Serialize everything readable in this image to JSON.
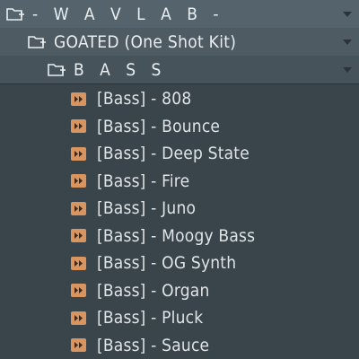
{
  "browser": {
    "root": {
      "label": "- W A V L A B -"
    },
    "kit": {
      "label": "GOATED (One Shot Kit)"
    },
    "subfolder": {
      "label": "B A S S"
    },
    "samples": [
      {
        "label": "[Bass] - 808"
      },
      {
        "label": "[Bass] - Bounce"
      },
      {
        "label": "[Bass] - Deep State"
      },
      {
        "label": "[Bass] - Fire"
      },
      {
        "label": "[Bass] - Juno"
      },
      {
        "label": "[Bass] - Moogy Bass"
      },
      {
        "label": "[Bass] - OG Synth"
      },
      {
        "label": "[Bass] - Organ"
      },
      {
        "label": "[Bass] - Pluck"
      },
      {
        "label": "[Bass] - Sauce"
      }
    ],
    "colors": {
      "background": "#3a444b",
      "folder_highlight": "#55636c",
      "sample_icon": "#d8955f",
      "text": "#e9eef0"
    },
    "icons": {
      "folder": "folder-open-icon",
      "sample": "audio-file-icon",
      "expand": "chevron-down-icon"
    }
  }
}
